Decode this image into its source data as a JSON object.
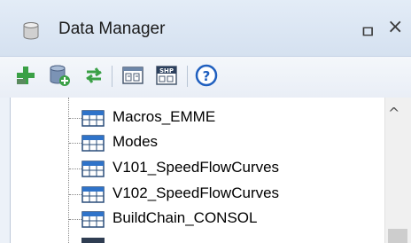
{
  "panel": {
    "title": "Data Manager",
    "pin_glyph": "ㅁ",
    "close_glyph": "×"
  },
  "toolbar": {
    "buttons": [
      {
        "icon": "add-icon"
      },
      {
        "icon": "add-database-icon"
      },
      {
        "icon": "refresh-icon"
      },
      {
        "icon": "import-table-icon"
      },
      {
        "icon": "shp-file-icon"
      },
      {
        "icon": "help-icon"
      }
    ],
    "shp_text": "SHP",
    "help_text": "?"
  },
  "tree": {
    "items": [
      {
        "label": "Macros_EMME",
        "icon": "table-icon"
      },
      {
        "label": "Modes",
        "icon": "table-icon"
      },
      {
        "label": "V101_SpeedFlowCurves",
        "icon": "table-icon"
      },
      {
        "label": "V102_SpeedFlowCurves",
        "icon": "table-icon"
      },
      {
        "label": "BuildChain_CONSOL",
        "icon": "table-icon"
      }
    ]
  },
  "scrollbar": {
    "up_glyph": "^"
  },
  "colors": {
    "title_bg": "#dce6f3",
    "add_green": "#3aa046",
    "help_blue": "#1f5fbf",
    "table_icon_blue": "#2f73c9"
  }
}
